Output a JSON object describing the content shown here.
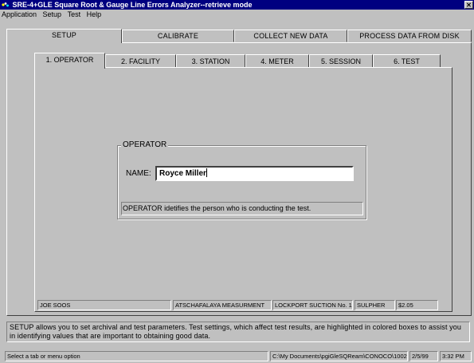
{
  "window": {
    "title": "SRE-4+GLE Square Root & Gauge Line Errors Analyzer--retrieve mode",
    "close_glyph": "✕"
  },
  "menu": {
    "items": [
      "Application",
      "Setup",
      "Test",
      "Help"
    ]
  },
  "main_tabs": [
    "SETUP",
    "CALIBRATE",
    "COLLECT NEW DATA",
    "PROCESS DATA FROM DISK"
  ],
  "sub_tabs": [
    "1. OPERATOR",
    "2. FACILITY",
    "3. STATION",
    "4. METER",
    "5. SESSION",
    "6. TEST"
  ],
  "operator": {
    "group_title": "OPERATOR",
    "name_label": "NAME:",
    "name_value": "Royce Miller",
    "hint": "OPERATOR idetifies the person who is conducting the test."
  },
  "summary": {
    "operator": "JOE SOOS",
    "facility": "ATSCHAFALAYA MEASURMENT",
    "station": "LOCKPORT SUCTION No. 1",
    "meter": "SULPHER",
    "session": "$2.05"
  },
  "info_text": "SETUP allows you to set archival and test parameters.  Test settings, which affect test results, are highlighted in colored boxes to assist you in identifying values that are important to obtaining good data.",
  "statusbar": {
    "message": "Select a tab or menu option",
    "path": "C:\\My Documents\\pgiGleSQReam\\CONOCO\\10027",
    "date": "2/5/99",
    "time": "3:32 PM"
  }
}
